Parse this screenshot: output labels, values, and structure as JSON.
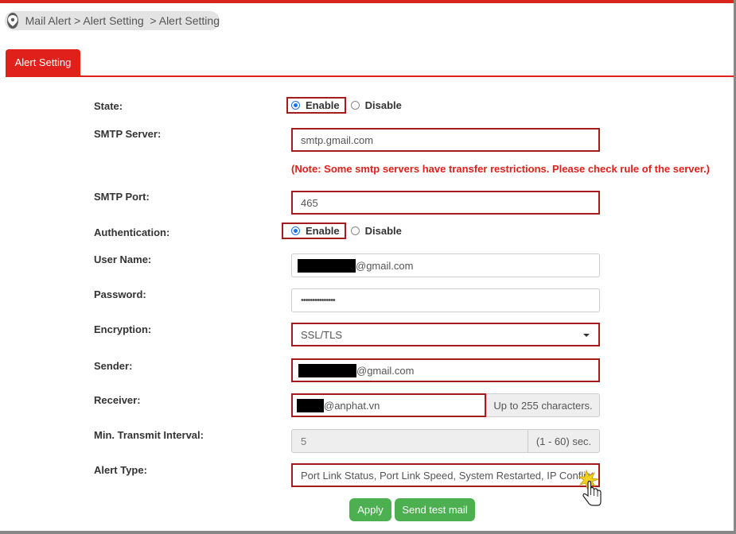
{
  "breadcrumb": {
    "text": "Mail Alert > Alert Setting  > Alert Setting",
    "icon": "location-pin-icon"
  },
  "tabs": [
    {
      "label": "Alert Setting",
      "active": true
    }
  ],
  "form": {
    "state": {
      "label": "State:",
      "options": [
        "Enable",
        "Disable"
      ],
      "selected": "Enable"
    },
    "smtp_server": {
      "label": "SMTP Server:",
      "value": "smtp.gmail.com",
      "note": "(Note: Some smtp servers have transfer restrictions. Please check rule of the server.)"
    },
    "smtp_port": {
      "label": "SMTP Port:",
      "value": "465"
    },
    "authentication": {
      "label": "Authentication:",
      "options": [
        "Enable",
        "Disable"
      ],
      "selected": "Enable"
    },
    "user_name": {
      "label": "User Name:",
      "value_suffix": "@gmail.com"
    },
    "password": {
      "label": "Password:",
      "value": "•••••••••••••••"
    },
    "encryption": {
      "label": "Encryption:",
      "value": "SSL/TLS"
    },
    "sender": {
      "label": "Sender:",
      "value_suffix": "@gmail.com"
    },
    "receiver": {
      "label": "Receiver:",
      "value_suffix": "@anphat.vn",
      "addon": "Up to 255 characters."
    },
    "min_interval": {
      "label": "Min. Transmit Interval:",
      "value": "5",
      "addon": "(1 - 60) sec."
    },
    "alert_type": {
      "label": "Alert Type:",
      "value": "Port Link Status, Port Link Speed, System Restarted, IP Conflict"
    }
  },
  "buttons": {
    "apply": "Apply",
    "send_test": "Send test mail"
  },
  "colors": {
    "accent": "#e0201b",
    "highlight_border": "#a61b1b",
    "button": "#4caf50",
    "note": "#e0201b"
  }
}
